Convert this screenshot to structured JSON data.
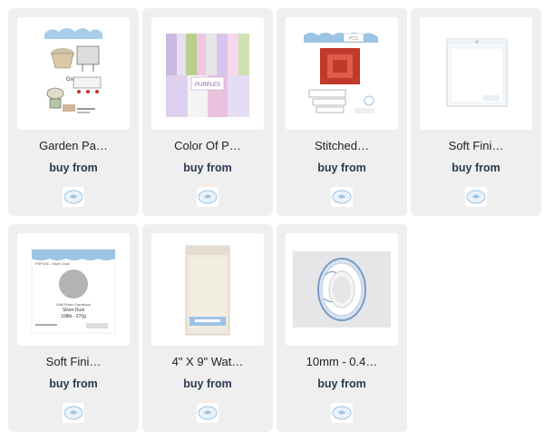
{
  "products": [
    {
      "title": "Garden Pa…",
      "buy_label": "buy from",
      "image": "garden-stamp-set",
      "store_logo": "elizabeth-craft-logo-icon"
    },
    {
      "title": "Color Of P…",
      "buy_label": "buy from",
      "image": "paper-pad-purples",
      "store_logo": "elizabeth-craft-logo-icon"
    },
    {
      "title": "Stitched…",
      "buy_label": "buy from",
      "image": "stitched-frame-dies",
      "store_logo": "elizabeth-craft-logo-icon"
    },
    {
      "title": "Soft Fini…",
      "buy_label": "buy from",
      "image": "clear-sleeve-pack",
      "store_logo": "elizabeth-craft-logo-icon"
    },
    {
      "title": "Soft Fini…",
      "buy_label": "buy from",
      "image": "silver-cardstock-pack",
      "store_logo": "elizabeth-craft-logo-icon"
    },
    {
      "title": "4\" X 9\" Wat…",
      "buy_label": "buy from",
      "image": "watercolor-paper-pack",
      "store_logo": "elizabeth-craft-logo-icon"
    },
    {
      "title": "10mm - 0.4…",
      "buy_label": "buy from",
      "image": "clear-double-sided-tape",
      "store_logo": "elizabeth-craft-logo-icon"
    }
  ],
  "colors": {
    "card_bg": "#efefef",
    "buy_text": "#2a3a52",
    "brand_blue": "#9cc4e4"
  },
  "thumb_text": {
    "garden_caption": "Grow",
    "paper_brand": "PURPLES",
    "stitched_label": "PCS",
    "silver_code": "PSP106 - Silver Dust",
    "silver_name": "Silver Dust",
    "silver_sub": "Soft Finish Cardstock",
    "silver_weight": "108lb - 270g"
  }
}
